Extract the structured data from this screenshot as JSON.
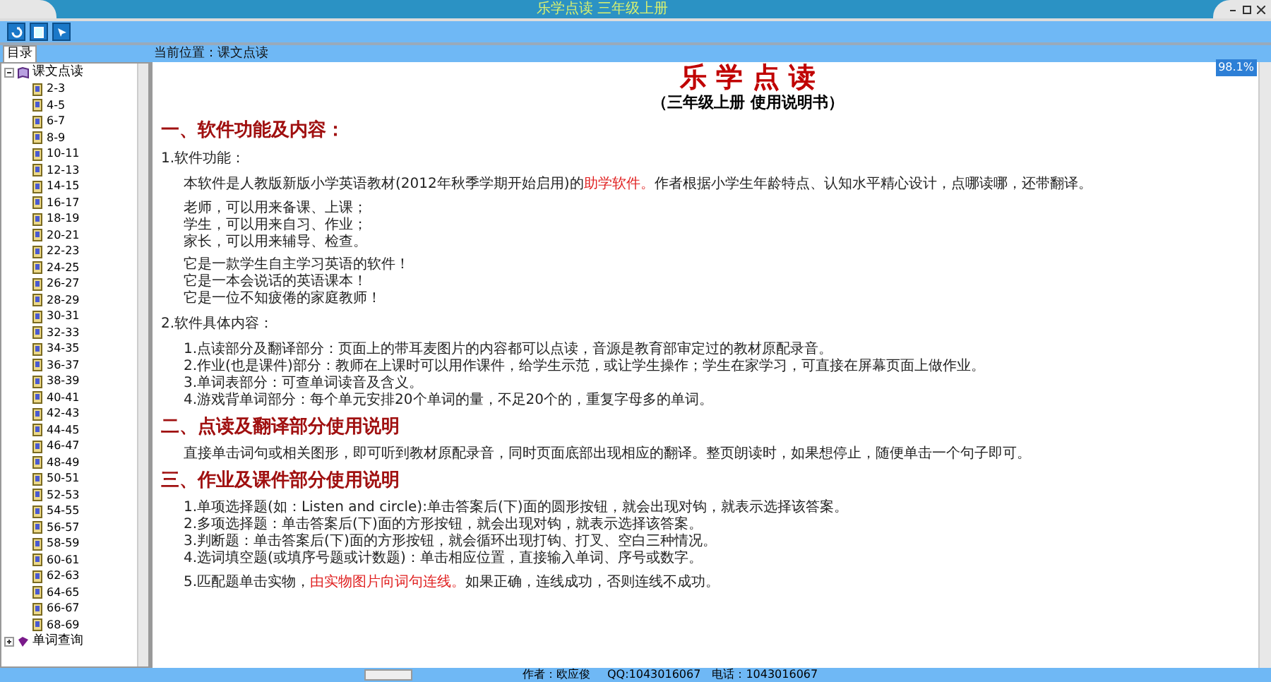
{
  "window": {
    "title": "乐学点读  三年级上册"
  },
  "toolbar": {
    "buttons": [
      {
        "kind": "refresh"
      },
      {
        "kind": "page"
      },
      {
        "kind": "pointer"
      }
    ]
  },
  "sidebar": {
    "tab": "目录",
    "tree": [
      {
        "label": "课文点读",
        "expanded": true,
        "kind": "book",
        "children": [
          {
            "label": "2-3"
          },
          {
            "label": "4-5"
          },
          {
            "label": "6-7"
          },
          {
            "label": "8-9"
          },
          {
            "label": "10-11"
          },
          {
            "label": "12-13"
          },
          {
            "label": "14-15"
          },
          {
            "label": "16-17"
          },
          {
            "label": "18-19"
          },
          {
            "label": "20-21"
          },
          {
            "label": "22-23"
          },
          {
            "label": "24-25"
          },
          {
            "label": "26-27"
          },
          {
            "label": "28-29"
          },
          {
            "label": "30-31"
          },
          {
            "label": "32-33"
          },
          {
            "label": "34-35"
          },
          {
            "label": "36-37"
          },
          {
            "label": "38-39"
          },
          {
            "label": "40-41"
          },
          {
            "label": "42-43"
          },
          {
            "label": "44-45"
          },
          {
            "label": "46-47"
          },
          {
            "label": "48-49"
          },
          {
            "label": "50-51"
          },
          {
            "label": "52-53"
          },
          {
            "label": "54-55"
          },
          {
            "label": "56-57"
          },
          {
            "label": "58-59"
          },
          {
            "label": "60-61"
          },
          {
            "label": "62-63"
          },
          {
            "label": "64-65"
          },
          {
            "label": "66-67"
          },
          {
            "label": "68-69"
          }
        ]
      },
      {
        "label": "单词查询",
        "expanded": false,
        "kind": "gem"
      }
    ]
  },
  "breadcrumb": "当前位置：课文点读",
  "overlay_badge": "98.1%",
  "document": {
    "title": "乐 学 点 读",
    "subtitle": "（三年级上册  使用说明书）",
    "blocks": [
      {
        "kind": "heading",
        "text": "一、软件功能及内容："
      },
      {
        "kind": "label",
        "text": "1.软件功能："
      },
      {
        "kind": "para",
        "segments": [
          {
            "text": "本软件是人教版新版小学英语教材(2012年秋季学期开始启用)的",
            "red": false
          },
          {
            "text": "助学软件。",
            "red": true
          },
          {
            "text": "作者根据小学生年龄特点、认知水平精心设计，点哪读哪，还带翻译。",
            "red": false
          }
        ]
      },
      {
        "kind": "lines",
        "lines": [
          "老师，可以用来备课、上课；",
          "学生，可以用来自习、作业；",
          "家长，可以用来辅导、检查。"
        ]
      },
      {
        "kind": "lines",
        "lines": [
          "它是一款学生自主学习英语的软件！",
          "它是一本会说话的英语课本！",
          "它是一位不知疲倦的家庭教师！"
        ]
      },
      {
        "kind": "label",
        "text": "2.软件具体内容："
      },
      {
        "kind": "lines",
        "lines": [
          "1.点读部分及翻译部分：页面上的带耳麦图片的内容都可以点读，音源是教育部审定过的教材原配录音。",
          "2.作业(也是课件)部分：教师在上课时可以用作课件，给学生示范，或让学生操作；学生在家学习，可直接在屏幕页面上做作业。",
          "3.单词表部分：可查单词读音及含义。",
          "4.游戏背单词部分：每个单元安排20个单词的量，不足20个的，重复字母多的单词。"
        ]
      },
      {
        "kind": "heading",
        "text": "二、点读及翻译部分使用说明"
      },
      {
        "kind": "para",
        "segments": [
          {
            "text": "直接单击词句或相关图形，即可听到教材原配录音，同时页面底部出现相应的翻译。整页朗读时，如果想停止，随便单击一个句子即可。",
            "red": false
          }
        ]
      },
      {
        "kind": "heading",
        "text": "三、作业及课件部分使用说明"
      },
      {
        "kind": "lines",
        "lines": [
          "1.单项选择题(如：Listen and circle):单击答案后(下)面的圆形按钮，就会出现对钩，就表示选择该答案。",
          "2.多项选择题：单击答案后(下)面的方形按钮，就会出现对钩，就表示选择该答案。",
          "3.判断题：单击答案后(下)面的方形按钮，就会循环出现打钩、打叉、空白三种情况。",
          "4.选词填空题(或填序号题或计数题)：单击相应位置，直接输入单词、序号或数字。"
        ]
      },
      {
        "kind": "para",
        "segments": [
          {
            "text": "5.匹配题单击实物，",
            "red": false
          },
          {
            "text": "由实物图片向词句连线。",
            "red": true
          },
          {
            "text": "如果正确，连线成功，否则连线不成功。",
            "red": false
          }
        ]
      }
    ]
  },
  "status_bar": {
    "author": "作者：欧应俊",
    "qq": "QQ:1043016067",
    "phone": "电话：1043016067"
  }
}
